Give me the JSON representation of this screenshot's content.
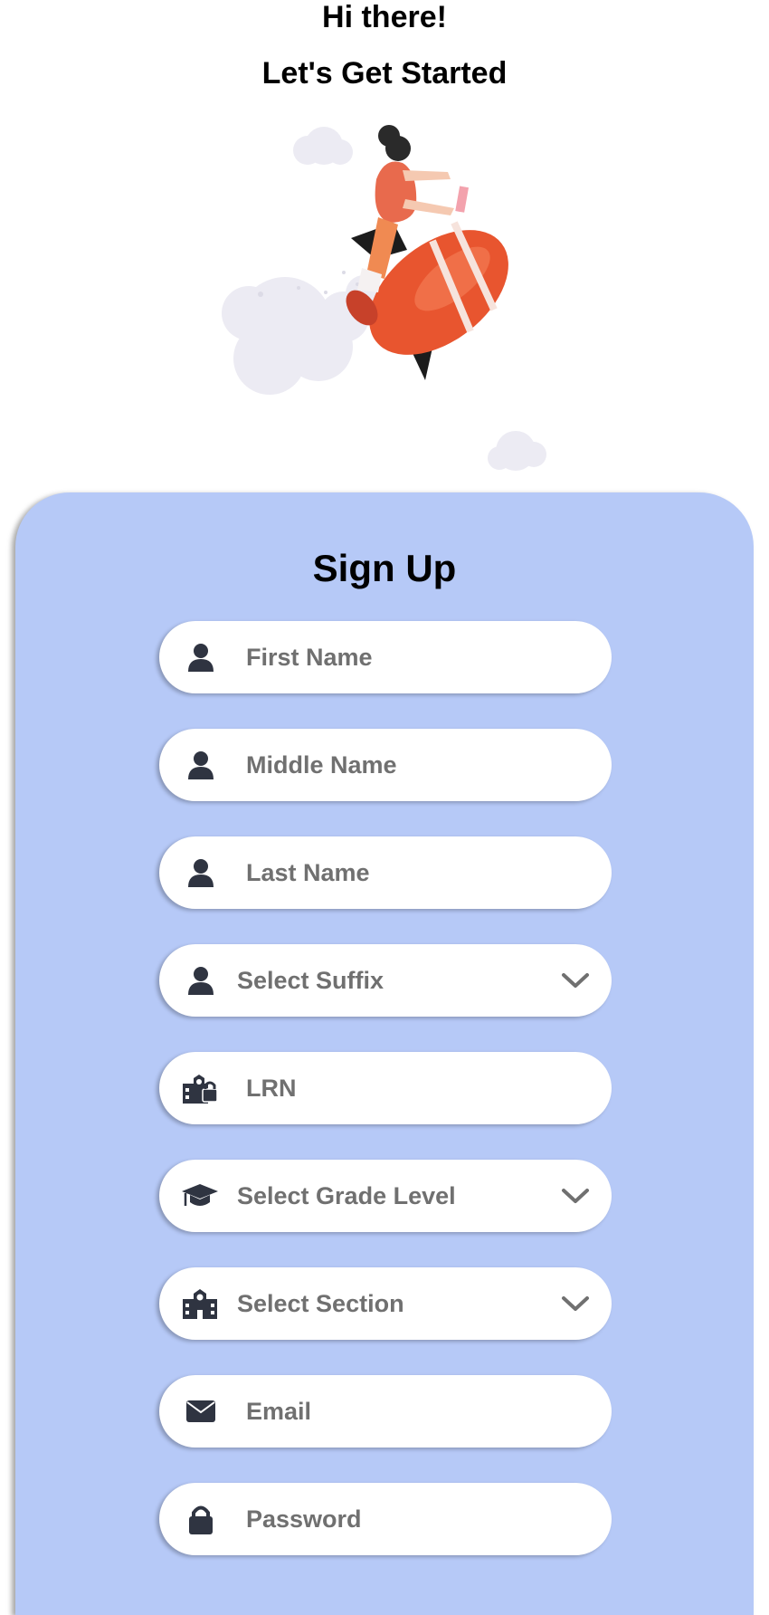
{
  "header": {
    "greeting": "Hi there!",
    "subtitle": "Let's Get Started"
  },
  "hero": {
    "icon": "rocket-rider-illustration"
  },
  "form": {
    "title": "Sign Up",
    "fields": [
      {
        "placeholder": "First Name",
        "icon": "user-icon",
        "type": "text"
      },
      {
        "placeholder": "Middle Name",
        "icon": "user-icon",
        "type": "text"
      },
      {
        "placeholder": "Last Name",
        "icon": "user-icon",
        "type": "text"
      },
      {
        "placeholder": "Select Suffix",
        "icon": "user-icon",
        "type": "select"
      },
      {
        "placeholder": "LRN",
        "icon": "school-lock-icon",
        "type": "text"
      },
      {
        "placeholder": "Select Grade Level",
        "icon": "graduation-cap-icon",
        "type": "select"
      },
      {
        "placeholder": "Select Section",
        "icon": "school-icon",
        "type": "select"
      },
      {
        "placeholder": "Email",
        "icon": "envelope-icon",
        "type": "text"
      },
      {
        "placeholder": "Password",
        "icon": "lock-icon",
        "type": "password"
      }
    ]
  },
  "colors": {
    "card": "#b6c9f7",
    "field_bg": "#ffffff",
    "placeholder_text": "#707070",
    "icon": "#2f3441"
  }
}
